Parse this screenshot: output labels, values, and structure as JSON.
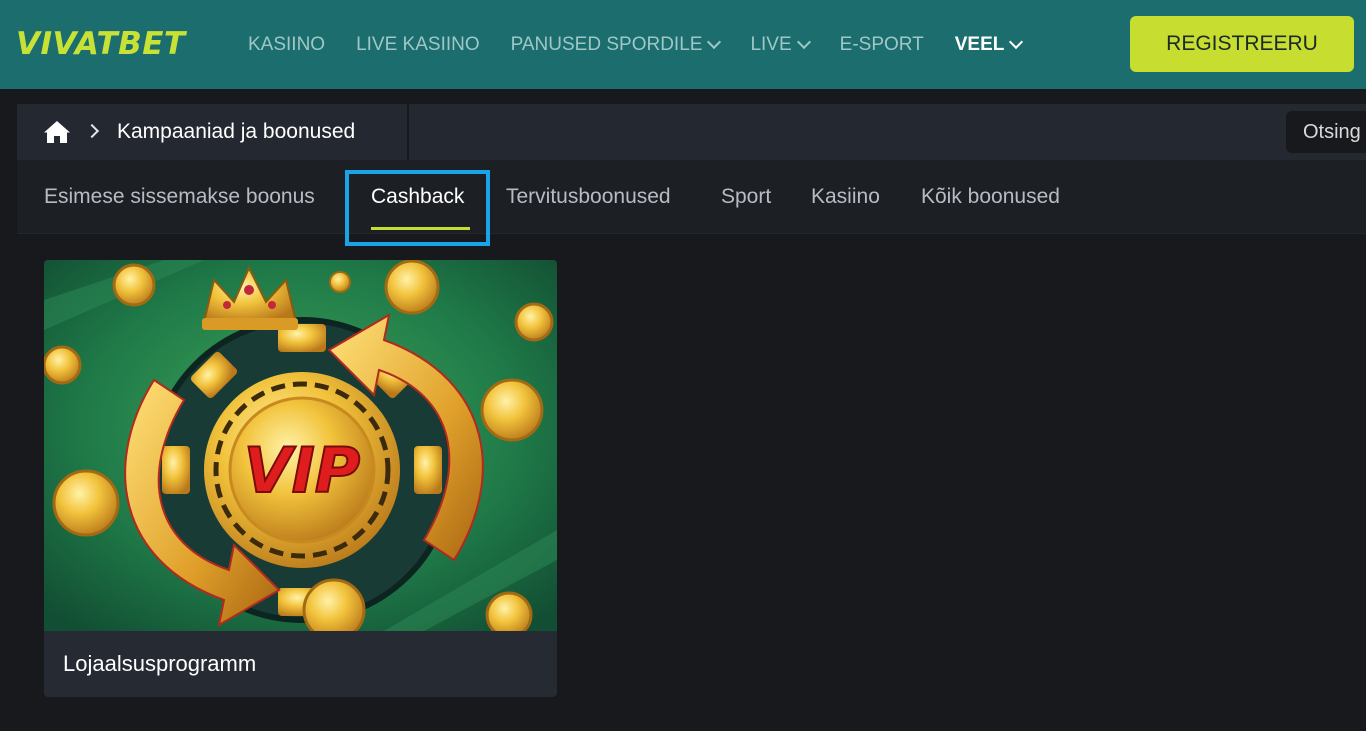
{
  "header": {
    "logo": "VIVATBET",
    "nav": [
      {
        "label": "KASIINO",
        "has_dropdown": false
      },
      {
        "label": "LIVE KASIINO",
        "has_dropdown": false
      },
      {
        "label": "PANUSED SPORDILE",
        "has_dropdown": true
      },
      {
        "label": "LIVE",
        "has_dropdown": true
      },
      {
        "label": "E-SPORT",
        "has_dropdown": false
      },
      {
        "label": "VEEL",
        "has_dropdown": true
      }
    ],
    "register_label": "REGISTREERU"
  },
  "breadcrumb": {
    "home_icon": "home-icon",
    "current": "Kampaaniad ja boonused",
    "search_placeholder": "Otsing"
  },
  "tabs": [
    {
      "label": "Esimese sissemakse boonus"
    },
    {
      "label": "Cashback",
      "active": true
    },
    {
      "label": "Tervitusboonused"
    },
    {
      "label": "Sport"
    },
    {
      "label": "Kasiino"
    },
    {
      "label": "Kõik boonused"
    }
  ],
  "promo_card": {
    "image_text": "VIP",
    "title": "Lojaalsusprogramm"
  },
  "colors": {
    "header_bg": "#1b6d6e",
    "accent": "#c7dd2f",
    "highlight": "#1aa3e8",
    "page_bg": "#17191d"
  }
}
